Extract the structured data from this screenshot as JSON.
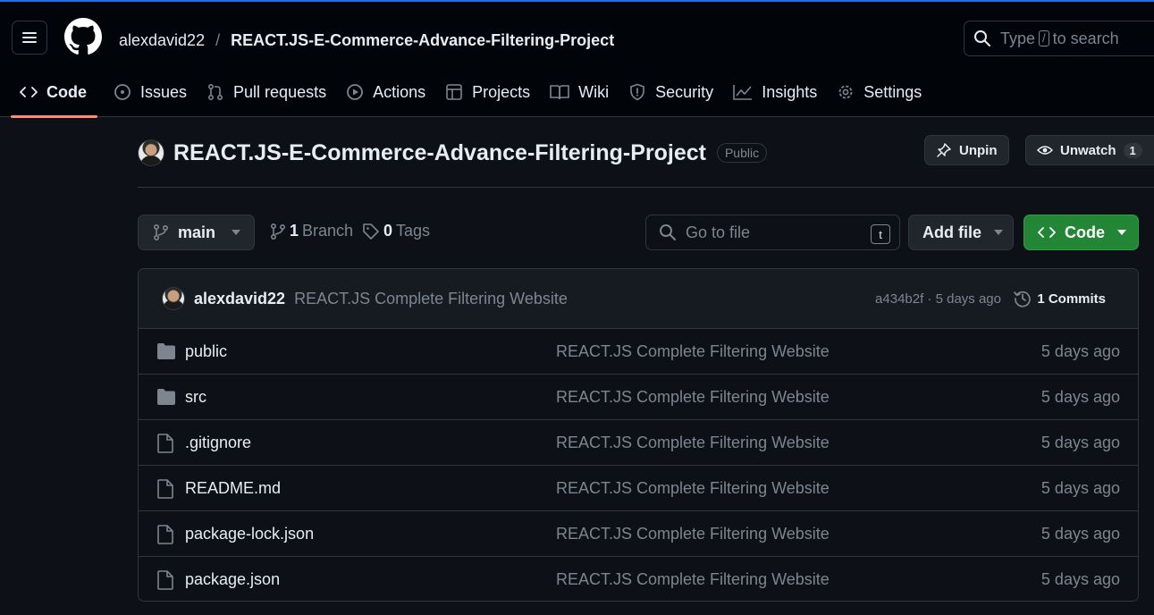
{
  "header": {
    "owner": "alexdavid22",
    "separator": "/",
    "repo": "REACT.JS-E-Commerce-Advance-Filtering-Project",
    "search": {
      "prefix": "Type",
      "key": "/",
      "suffix": "to search"
    }
  },
  "tabs": [
    {
      "label": "Code",
      "icon": "code-icon",
      "active": true
    },
    {
      "label": "Issues",
      "icon": "issue-icon"
    },
    {
      "label": "Pull requests",
      "icon": "pull-request-icon"
    },
    {
      "label": "Actions",
      "icon": "play-icon"
    },
    {
      "label": "Projects",
      "icon": "table-icon"
    },
    {
      "label": "Wiki",
      "icon": "book-icon"
    },
    {
      "label": "Security",
      "icon": "shield-icon"
    },
    {
      "label": "Insights",
      "icon": "graph-icon"
    },
    {
      "label": "Settings",
      "icon": "gear-icon"
    }
  ],
  "repo_header": {
    "title": "REACT.JS-E-Commerce-Advance-Filtering-Project",
    "visibility": "Public",
    "unpin_label": "Unpin",
    "unwatch_label": "Unwatch",
    "watch_count": "1"
  },
  "branch_bar": {
    "branch": "main",
    "branch_count": "1",
    "branch_label": "Branch",
    "tag_count": "0",
    "tag_label": "Tags",
    "goto_placeholder": "Go to file",
    "goto_key": "t",
    "add_file_label": "Add file",
    "code_label": "Code"
  },
  "latest_commit": {
    "author": "alexdavid22",
    "message": "REACT.JS Complete Filtering Website",
    "hash_info": "a434b2f · 5 days ago",
    "commits_label": "1 Commits"
  },
  "files": [
    {
      "name": "public",
      "type": "folder",
      "message": "REACT.JS Complete Filtering Website",
      "date": "5 days ago"
    },
    {
      "name": "src",
      "type": "folder",
      "message": "REACT.JS Complete Filtering Website",
      "date": "5 days ago"
    },
    {
      "name": ".gitignore",
      "type": "file",
      "message": "REACT.JS Complete Filtering Website",
      "date": "5 days ago"
    },
    {
      "name": "README.md",
      "type": "file",
      "message": "REACT.JS Complete Filtering Website",
      "date": "5 days ago"
    },
    {
      "name": "package-lock.json",
      "type": "file",
      "message": "REACT.JS Complete Filtering Website",
      "date": "5 days ago"
    },
    {
      "name": "package.json",
      "type": "file",
      "message": "REACT.JS Complete Filtering Website",
      "date": "5 days ago"
    }
  ],
  "colors": {
    "background": "#0d1117",
    "header_background": "#010409",
    "active_tab_underline": "#fd8c73",
    "code_button": "#238636",
    "muted_text": "#7d8590"
  }
}
